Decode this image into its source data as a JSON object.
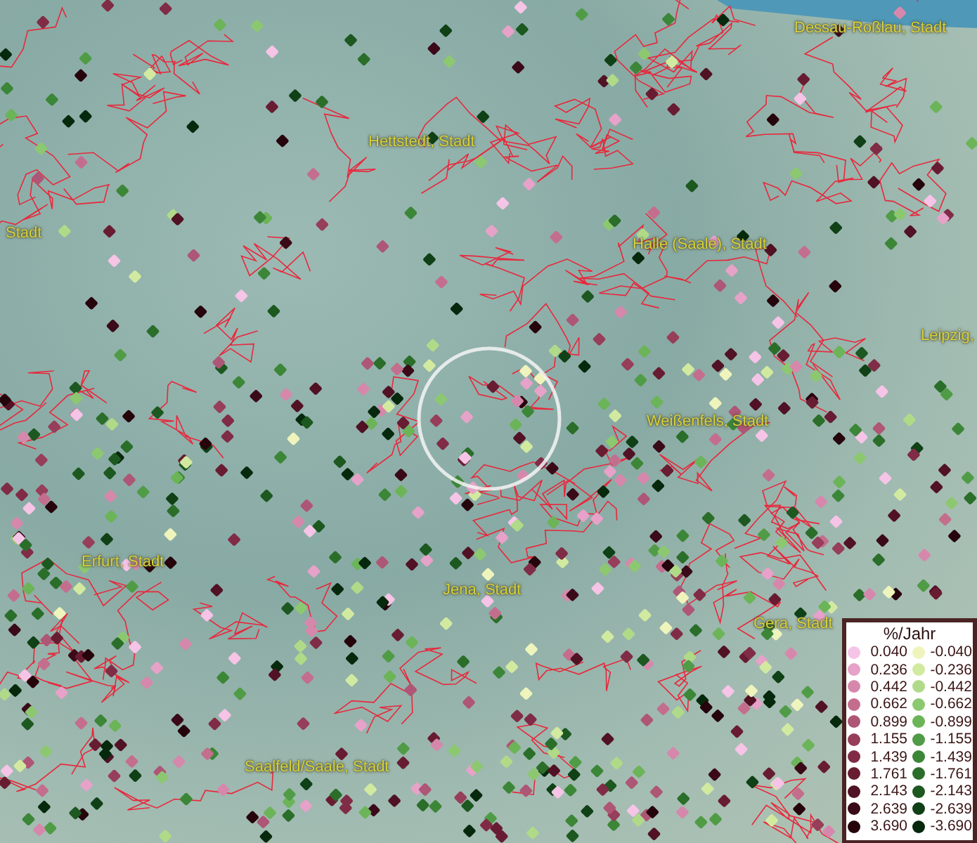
{
  "map": {
    "place_labels": [
      {
        "label": "Dessau-Roßlau, Stadt"
      },
      {
        "label": "Hettstedt, Stadt"
      },
      {
        "label": "Stadt"
      },
      {
        "label": "Halle (Saale), Stadt"
      },
      {
        "label": "Leipzig,"
      },
      {
        "label": "Weißenfels, Stadt"
      },
      {
        "label": "Erfurt, Stadt"
      },
      {
        "label": "Jena, Stadt"
      },
      {
        "label": "Gera, Stadt"
      },
      {
        "label": "Saalfeld/Saale, Stadt"
      }
    ]
  },
  "legend": {
    "title": "%/Jahr",
    "columns": [
      {
        "entries": [
          {
            "label": "0.040",
            "color": "#f5c4e6"
          },
          {
            "label": "0.236",
            "color": "#e6a2c8"
          },
          {
            "label": "0.442",
            "color": "#d688ac"
          },
          {
            "label": "0.662",
            "color": "#c46e8e"
          },
          {
            "label": "0.899",
            "color": "#ae5676"
          },
          {
            "label": "1.155",
            "color": "#963e5a"
          },
          {
            "label": "1.439",
            "color": "#802c46"
          },
          {
            "label": "1.761",
            "color": "#681c32"
          },
          {
            "label": "2.143",
            "color": "#501224"
          },
          {
            "label": "2.639",
            "color": "#3a0a18"
          },
          {
            "label": "3.690",
            "color": "#26040c"
          }
        ]
      },
      {
        "entries": [
          {
            "label": "-0.040",
            "color": "#eef4bc"
          },
          {
            "label": "-0.236",
            "color": "#d2eaa0"
          },
          {
            "label": "-0.442",
            "color": "#b0da88"
          },
          {
            "label": "-0.662",
            "color": "#8cc870"
          },
          {
            "label": "-0.899",
            "color": "#6cb458"
          },
          {
            "label": "-1.155",
            "color": "#509c46"
          },
          {
            "label": "-1.439",
            "color": "#3c8638"
          },
          {
            "label": "-1.761",
            "color": "#2a6e2a"
          },
          {
            "label": "-2.143",
            "color": "#1c5820"
          },
          {
            "label": "-2.639",
            "color": "#0f4016"
          },
          {
            "label": "-3.690",
            "color": "#06280c"
          }
        ]
      }
    ]
  }
}
